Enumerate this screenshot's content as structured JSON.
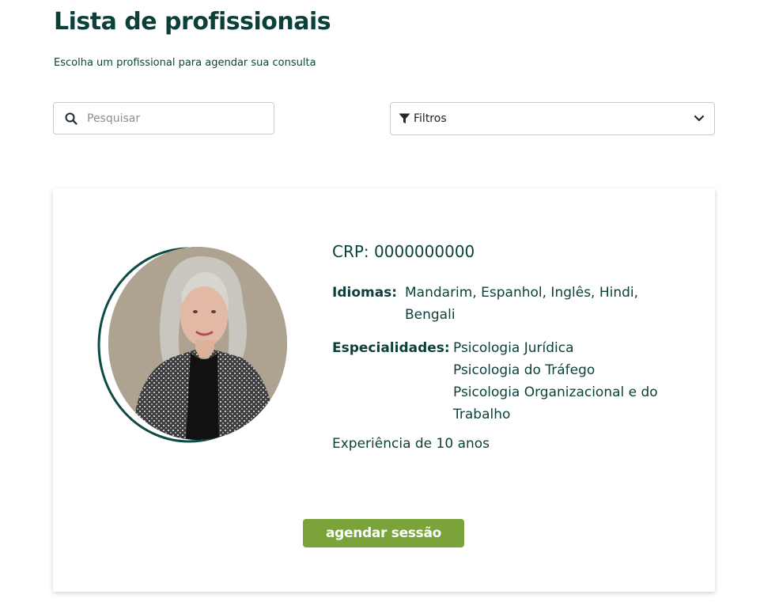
{
  "header": {
    "title": "Lista de profissionais",
    "subtitle": "Escolha um profissional para agendar sua consulta"
  },
  "search": {
    "placeholder": "Pesquisar",
    "value": "",
    "icon": "search-icon"
  },
  "filters": {
    "label": "Filtros",
    "icon": "funnel-icon",
    "dropdown_icon": "chevron-down-icon"
  },
  "professional": {
    "crp": "CRP: 0000000000",
    "languages_label": "Idiomas:",
    "languages_line1": "Mandarim, Espanhol, Inglês, Hindi,",
    "languages_line2": "Bengali",
    "specialties_label": "Especialidades:",
    "specialties": [
      "Psicologia Jurídica",
      "Psicologia do Tráfego",
      "Psicologia Organizacional e do",
      "Trabalho"
    ],
    "experience": "Experiência de 10 anos",
    "book_button": "agendar sessão"
  },
  "colors": {
    "primary_text": "#0b3f3a",
    "button": "#7aa33a",
    "ring": "#0d4a44"
  }
}
